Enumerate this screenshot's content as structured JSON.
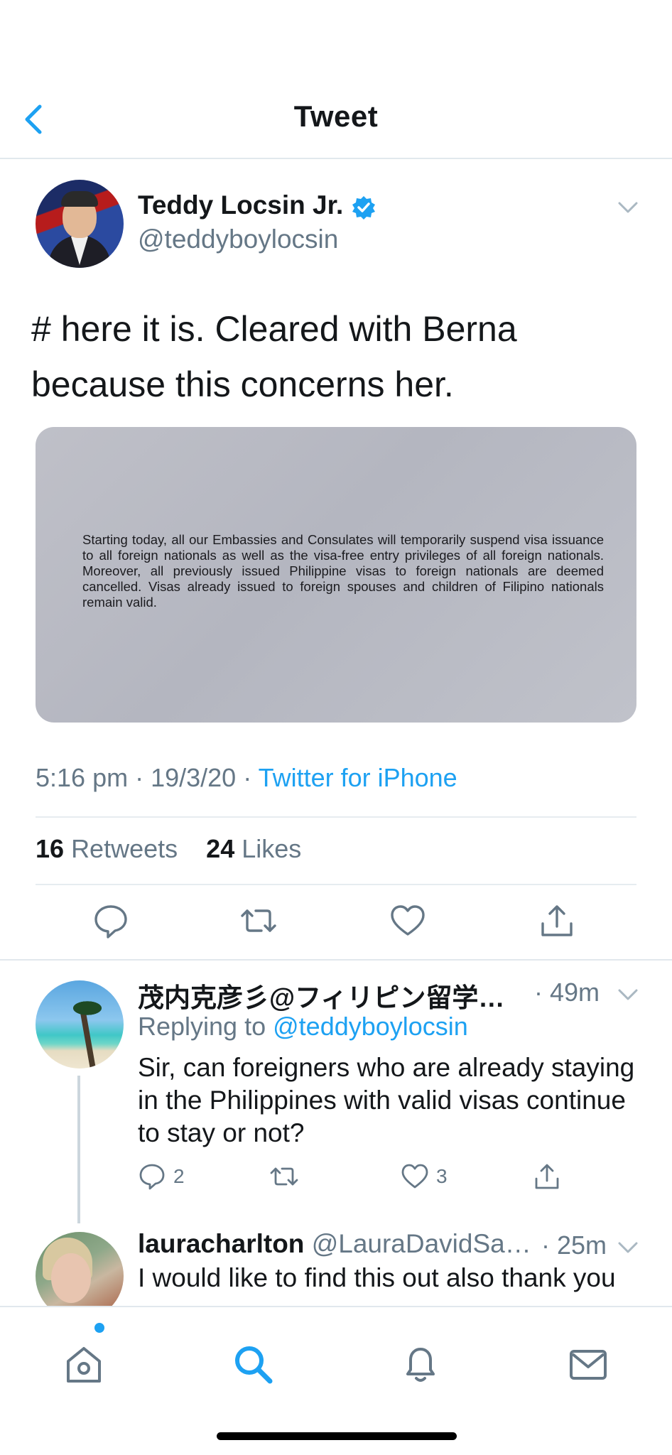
{
  "header": {
    "title": "Tweet"
  },
  "tweet": {
    "author_name": "Teddy Locsin Jr.",
    "author_handle": "@teddyboylocsin",
    "text": "# here it is. Cleared with Berna because this concerns her.",
    "media_text": "Starting today, all our Embassies and Consulates will temporarily suspend visa issuance to all foreign nationals as well as the visa-free entry privileges of all foreign nationals. Moreover, all previously issued Philippine visas to foreign nationals are deemed cancelled. Visas already issued to foreign spouses and children of Filipino nationals remain valid.",
    "time": "5:16 pm",
    "date": "19/3/20",
    "source": "Twitter for iPhone",
    "retweets_count": "16",
    "retweets_label": "Retweets",
    "likes_count": "24",
    "likes_label": "Likes"
  },
  "replies": [
    {
      "author_name": "茂内克彦彡@フィリピン留学…",
      "time": "· 49m",
      "replying_label": "Replying to",
      "replying_to": "@teddyboylocsin",
      "text": "Sir, can foreigners who are already staying in the Philippines with valid visas continue to stay or not?",
      "reply_count": "2",
      "like_count": "3"
    },
    {
      "author_name": "lauracharlton",
      "author_handle": "@LauraDavidSa…",
      "time": "· 25m",
      "text": "I would like to find this out also thank you"
    }
  ],
  "colors": {
    "accent": "#1da1f2",
    "secondary_text": "#657786",
    "primary_text": "#14171a",
    "divider": "#e1e8ed"
  },
  "tabbar": {
    "icons": [
      "home-icon",
      "search-icon",
      "notifications-icon",
      "messages-icon"
    ],
    "active": "search-icon"
  }
}
